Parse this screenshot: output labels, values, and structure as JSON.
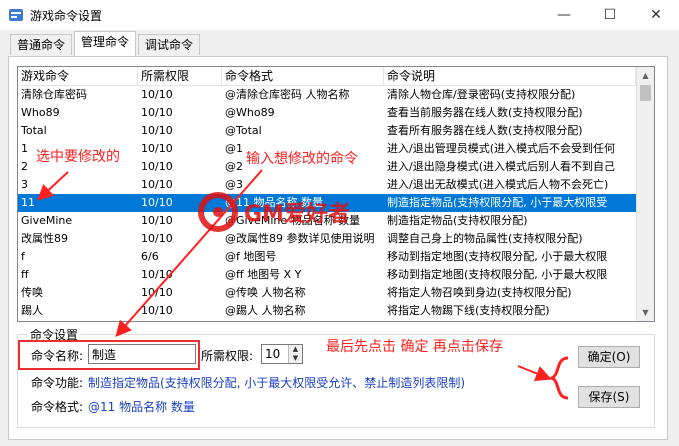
{
  "window": {
    "title": "游戏命令设置",
    "minimize": "—",
    "maximize": "☐",
    "close": "✕"
  },
  "tabs": [
    {
      "label": "普通命令"
    },
    {
      "label": "管理命令"
    },
    {
      "label": "调试命令"
    }
  ],
  "table": {
    "columns": [
      "游戏命令",
      "所需权限",
      "命令格式",
      "命令说明"
    ],
    "rows": [
      [
        "清除仓库密码",
        "10/10",
        "@清除仓库密码 人物名称",
        "清除人物仓库/登录密码(支持权限分配)"
      ],
      [
        "Who89",
        "10/10",
        "@Who89",
        "查看当前服务器在线人数(支持权限分配)"
      ],
      [
        "Total",
        "10/10",
        "@Total",
        "查看所有服务器在线人数(支持权限分配)"
      ],
      [
        "1",
        "10/10",
        "@1",
        "进入/退出管理员模式(进入模式后不会受到任何"
      ],
      [
        "2",
        "10/10",
        "@2",
        "进入/退出隐身模式(进入模式后别人看不到自己"
      ],
      [
        "3",
        "10/10",
        "@3",
        "进入/退出无敌模式(进入模式后人物不会死亡)"
      ],
      [
        "11",
        "10/10",
        "@11 物品名称 数量",
        "制造指定物品(支持权限分配, 小于最大权限受"
      ],
      [
        "GiveMine",
        "10/10",
        "@GiveMine 物品名称 数量",
        "制造指定物品(支持权限分配)"
      ],
      [
        "改属性89",
        "10/10",
        "@改属性89 参数详见使用说明",
        "调整自己身上的物品属性(支持权限分配)"
      ],
      [
        "f",
        "6/6",
        "@f 地图号",
        "移动到指定地图(支持权限分配, 小于最大权限"
      ],
      [
        "ff",
        "10/10",
        "@ff 地图号 X Y",
        "移动到指定地图(支持权限分配, 小于最大权限"
      ],
      [
        "传唤",
        "10/10",
        "@传唤 人物名称",
        "将指定人物召唤到身边(支持权限分配)"
      ],
      [
        "踢人",
        "10/10",
        "@踢人 人物名称",
        "将指定人物踢下线(支持权限分配)"
      ]
    ],
    "selected_index": 6
  },
  "settings": {
    "group_title": "命令设置",
    "name_label": "命令名称:",
    "name_value": "制造",
    "perm_label": "所需权限:",
    "perm_value": "10",
    "func_label": "命令功能:",
    "func_value": "制造指定物品(支持权限分配, 小于最大权限受允许、禁止制造列表限制)",
    "format_label": "命令格式:",
    "format_value": "@11 物品名称 数量"
  },
  "buttons": {
    "confirm": "确定(O)",
    "save": "保存(S)"
  },
  "annotations": {
    "select": "选中要修改的",
    "input": "输入想修改的命令",
    "final": "最后先点击 确定 再点击保存",
    "watermark": "GM爱好者"
  },
  "colors": {
    "selection": "#0078d7",
    "annotation": "#ff2020",
    "info_text": "#1a3fc0"
  }
}
